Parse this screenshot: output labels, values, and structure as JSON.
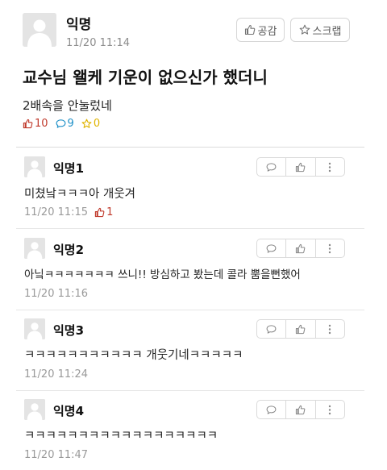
{
  "post": {
    "author": "익명",
    "time": "11/20 11:14",
    "title": "교수님 왤케 기운이 없으신가 했더니",
    "body": "2배속을 안눌렀네",
    "likes": "10",
    "comments": "9",
    "scraps": "0",
    "like_button_label": "공감",
    "scrap_button_label": "스크랩"
  },
  "comments": [
    {
      "author": "익명1",
      "text": "미쳤낰ㅋㅋㅋ아 개웃겨",
      "time": "11/20 11:15",
      "likes": "1"
    },
    {
      "author": "익명2",
      "text": "아닠ㅋㅋㅋㅋㅋㅋㅋ 쓰니!! 방심하고 봤는데 콜라 뿜을뻔했어",
      "time": "11/20 11:16"
    },
    {
      "author": "익명3",
      "text": "ㅋㅋㅋㅋㅋㅋㅋㅋㅋㅋㅋ 개웃기네ㅋㅋㅋㅋㅋ",
      "time": "11/20 11:24"
    },
    {
      "author": "익명4",
      "text": "ㅋㅋㅋㅋㅋㅋㅋㅋㅋㅋㅋㅋㅋㅋㅋㅋㅋㅋ",
      "time": "11/20 11:47"
    }
  ],
  "colors": {
    "like": "#c0392b",
    "comment": "#1e90c8",
    "scrap": "#e0b400",
    "muted": "#8d8d8d"
  },
  "icons": [
    "user-avatar-icon",
    "thumbs-up-icon",
    "star-icon",
    "speech-bubble-icon",
    "more-vertical-icon"
  ]
}
